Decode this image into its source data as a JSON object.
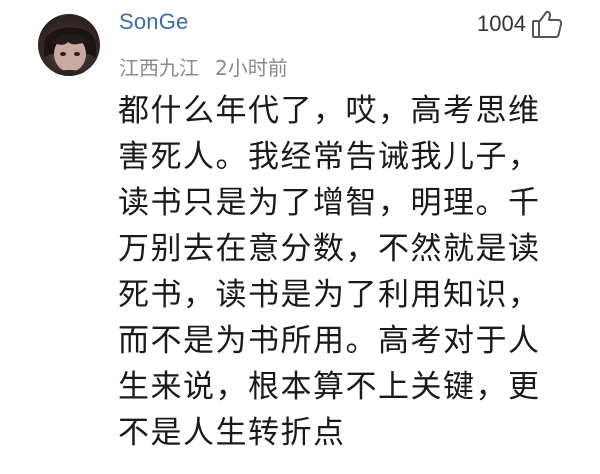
{
  "comment": {
    "username": "SonGe",
    "location": "江西九江",
    "time": "2小时前",
    "likes": "1004",
    "like_icon": "thumbs-up-icon",
    "avatar_icon": "user-avatar",
    "text_lines": [
      "都什么年代了，哎，高考思维",
      "害死人。我经常告诫我儿子，",
      "读书只是为了增智，明理。千",
      "万别去在意分数，不然就是读",
      "死书，读书是为了利用知识，",
      "而不是为书所用。高考对于人",
      "生来说，根本算不上关键，更",
      "不是人生转折点"
    ]
  },
  "colors": {
    "username": "#3b6ea5",
    "meta": "#8a8a8a",
    "text": "#1a1a1a",
    "background": "#ffffff"
  }
}
